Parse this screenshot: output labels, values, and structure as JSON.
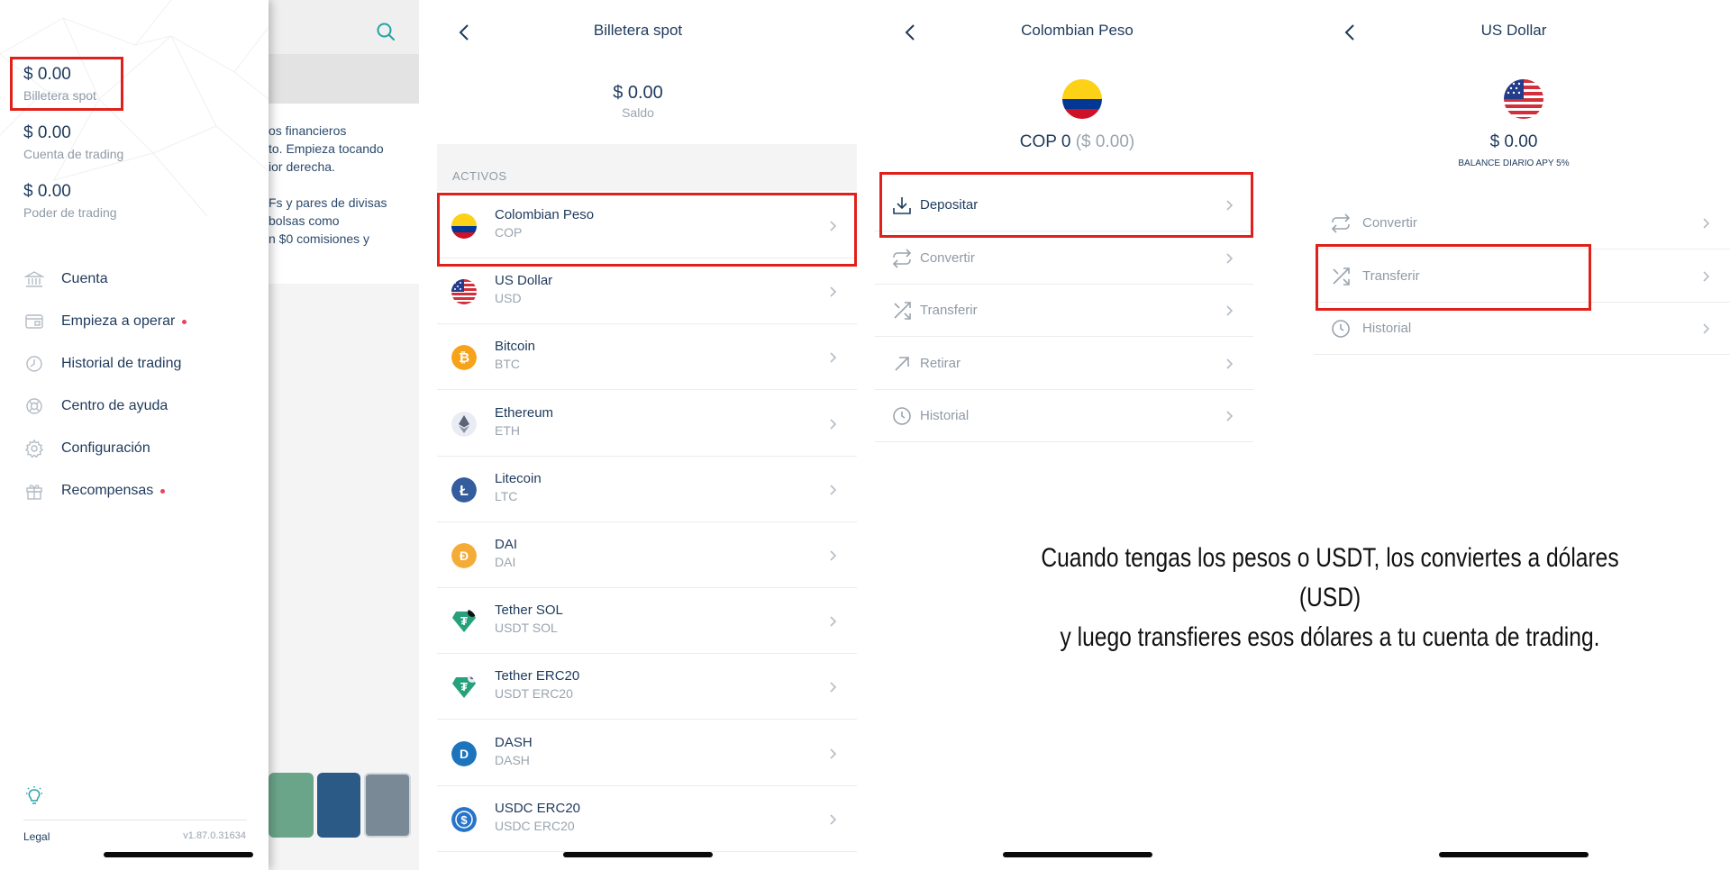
{
  "menu": {
    "balances": [
      {
        "amount": "$ 0.00",
        "label": "Billetera spot"
      },
      {
        "amount": "$ 0.00",
        "label": "Cuenta de trading"
      },
      {
        "amount": "$ 0.00",
        "label": "Poder de trading"
      }
    ],
    "items": [
      {
        "label": "Cuenta",
        "icon": "bank-icon",
        "dot": false
      },
      {
        "label": "Empieza a operar",
        "icon": "card-icon",
        "dot": true
      },
      {
        "label": "Historial de trading",
        "icon": "history-icon",
        "dot": false
      },
      {
        "label": "Centro de ayuda",
        "icon": "lifebuoy-icon",
        "dot": false
      },
      {
        "label": "Configuración",
        "icon": "gear-icon",
        "dot": false
      },
      {
        "label": "Recompensas",
        "icon": "gift-icon",
        "dot": true
      }
    ],
    "legal": "Legal",
    "version": "v1.87.0.31634",
    "background_lines": [
      "os financieros",
      "to. Empieza tocando",
      "ior derecha.",
      "",
      "Fs y pares de divisas",
      "bolsas como",
      "n $0 comisiones y"
    ]
  },
  "spot": {
    "title": "Billetera spot",
    "amount": "$ 0.00",
    "amount_label": "Saldo",
    "section": "ACTIVOS",
    "assets": [
      {
        "name": "Colombian Peso",
        "code": "COP",
        "icon": "colombia-flag-icon"
      },
      {
        "name": "US Dollar",
        "code": "USD",
        "icon": "us-flag-icon"
      },
      {
        "name": "Bitcoin",
        "code": "BTC",
        "icon": "bitcoin-icon"
      },
      {
        "name": "Ethereum",
        "code": "ETH",
        "icon": "ethereum-icon"
      },
      {
        "name": "Litecoin",
        "code": "LTC",
        "icon": "litecoin-icon"
      },
      {
        "name": "DAI",
        "code": "DAI",
        "icon": "dai-icon"
      },
      {
        "name": "Tether SOL",
        "code": "USDT SOL",
        "icon": "tether-sol-icon"
      },
      {
        "name": "Tether ERC20",
        "code": "USDT ERC20",
        "icon": "tether-erc20-icon"
      },
      {
        "name": "DASH",
        "code": "DASH",
        "icon": "dash-icon"
      },
      {
        "name": "USDC ERC20",
        "code": "USDC ERC20",
        "icon": "usdc-icon"
      }
    ]
  },
  "cop": {
    "title": "Colombian Peso",
    "balance_main": "COP 0",
    "balance_sub": "($ 0.00)",
    "actions": [
      {
        "label": "Depositar",
        "icon": "download-icon"
      },
      {
        "label": "Convertir",
        "icon": "convert-icon"
      },
      {
        "label": "Transferir",
        "icon": "transfer-icon"
      },
      {
        "label": "Retirar",
        "icon": "arrow-up-right-icon"
      },
      {
        "label": "Historial",
        "icon": "clock-icon"
      }
    ]
  },
  "usd": {
    "title": "US Dollar",
    "amount": "$ 0.00",
    "apy": "BALANCE DIARIO APY 5%",
    "actions": [
      {
        "label": "Convertir",
        "icon": "convert-icon"
      },
      {
        "label": "Transferir",
        "icon": "transfer-icon"
      },
      {
        "label": "Historial",
        "icon": "clock-icon"
      }
    ]
  },
  "caption": {
    "line1": "Cuando tengas los pesos o USDT, los conviertes a dólares (USD)",
    "line2": "y luego transfieres esos dólares a tu cuenta de trading."
  },
  "colors": {
    "highlight": "#e0211b",
    "navy": "#1e3a5c",
    "teal": "#22a3a3"
  }
}
